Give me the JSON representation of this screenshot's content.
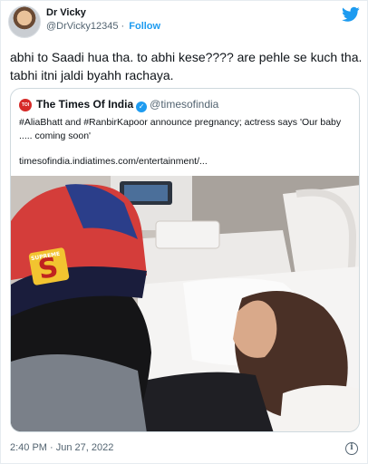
{
  "author": {
    "name": "Dr Vicky",
    "handle": "@DrVicky12345",
    "separator": "·",
    "follow_label": "Follow"
  },
  "tweet": {
    "text": "abhi to Saadi hua tha. to abhi kese????  are pehle se kuch tha. tabhi itni jaldi byahh rachaya."
  },
  "quoted_tweet": {
    "logo_text": "TOI",
    "name": "The Times Of India",
    "handle": "@timesofindia",
    "text": "#AliaBhatt and #RanbirKapoor announce pregnancy; actress says 'Our baby ..... coming soon'",
    "link": "timesofindia.indiatimes.com/entertainment/...",
    "image_cap_text": "SUPREME"
  },
  "footer": {
    "timestamp": "2:40 PM · Jun 27, 2022"
  },
  "icons": {
    "brand": "twitter-bird-icon",
    "verified": "verified-badge-icon",
    "info": "info-icon"
  },
  "colors": {
    "accent": "#1d9bf0",
    "text": "#0f1419",
    "muted": "#536471",
    "toi_red": "#d62a28"
  }
}
